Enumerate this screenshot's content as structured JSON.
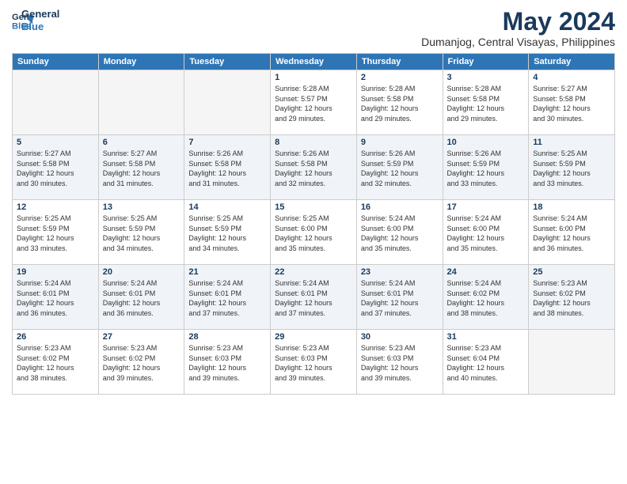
{
  "logo": {
    "line1": "General",
    "line2": "Blue"
  },
  "title": "May 2024",
  "subtitle": "Dumanjog, Central Visayas, Philippines",
  "weekdays": [
    "Sunday",
    "Monday",
    "Tuesday",
    "Wednesday",
    "Thursday",
    "Friday",
    "Saturday"
  ],
  "weeks": [
    [
      {
        "day": "",
        "info": ""
      },
      {
        "day": "",
        "info": ""
      },
      {
        "day": "",
        "info": ""
      },
      {
        "day": "1",
        "info": "Sunrise: 5:28 AM\nSunset: 5:57 PM\nDaylight: 12 hours\nand 29 minutes."
      },
      {
        "day": "2",
        "info": "Sunrise: 5:28 AM\nSunset: 5:58 PM\nDaylight: 12 hours\nand 29 minutes."
      },
      {
        "day": "3",
        "info": "Sunrise: 5:28 AM\nSunset: 5:58 PM\nDaylight: 12 hours\nand 29 minutes."
      },
      {
        "day": "4",
        "info": "Sunrise: 5:27 AM\nSunset: 5:58 PM\nDaylight: 12 hours\nand 30 minutes."
      }
    ],
    [
      {
        "day": "5",
        "info": "Sunrise: 5:27 AM\nSunset: 5:58 PM\nDaylight: 12 hours\nand 30 minutes."
      },
      {
        "day": "6",
        "info": "Sunrise: 5:27 AM\nSunset: 5:58 PM\nDaylight: 12 hours\nand 31 minutes."
      },
      {
        "day": "7",
        "info": "Sunrise: 5:26 AM\nSunset: 5:58 PM\nDaylight: 12 hours\nand 31 minutes."
      },
      {
        "day": "8",
        "info": "Sunrise: 5:26 AM\nSunset: 5:58 PM\nDaylight: 12 hours\nand 32 minutes."
      },
      {
        "day": "9",
        "info": "Sunrise: 5:26 AM\nSunset: 5:59 PM\nDaylight: 12 hours\nand 32 minutes."
      },
      {
        "day": "10",
        "info": "Sunrise: 5:26 AM\nSunset: 5:59 PM\nDaylight: 12 hours\nand 33 minutes."
      },
      {
        "day": "11",
        "info": "Sunrise: 5:25 AM\nSunset: 5:59 PM\nDaylight: 12 hours\nand 33 minutes."
      }
    ],
    [
      {
        "day": "12",
        "info": "Sunrise: 5:25 AM\nSunset: 5:59 PM\nDaylight: 12 hours\nand 33 minutes."
      },
      {
        "day": "13",
        "info": "Sunrise: 5:25 AM\nSunset: 5:59 PM\nDaylight: 12 hours\nand 34 minutes."
      },
      {
        "day": "14",
        "info": "Sunrise: 5:25 AM\nSunset: 5:59 PM\nDaylight: 12 hours\nand 34 minutes."
      },
      {
        "day": "15",
        "info": "Sunrise: 5:25 AM\nSunset: 6:00 PM\nDaylight: 12 hours\nand 35 minutes."
      },
      {
        "day": "16",
        "info": "Sunrise: 5:24 AM\nSunset: 6:00 PM\nDaylight: 12 hours\nand 35 minutes."
      },
      {
        "day": "17",
        "info": "Sunrise: 5:24 AM\nSunset: 6:00 PM\nDaylight: 12 hours\nand 35 minutes."
      },
      {
        "day": "18",
        "info": "Sunrise: 5:24 AM\nSunset: 6:00 PM\nDaylight: 12 hours\nand 36 minutes."
      }
    ],
    [
      {
        "day": "19",
        "info": "Sunrise: 5:24 AM\nSunset: 6:01 PM\nDaylight: 12 hours\nand 36 minutes."
      },
      {
        "day": "20",
        "info": "Sunrise: 5:24 AM\nSunset: 6:01 PM\nDaylight: 12 hours\nand 36 minutes."
      },
      {
        "day": "21",
        "info": "Sunrise: 5:24 AM\nSunset: 6:01 PM\nDaylight: 12 hours\nand 37 minutes."
      },
      {
        "day": "22",
        "info": "Sunrise: 5:24 AM\nSunset: 6:01 PM\nDaylight: 12 hours\nand 37 minutes."
      },
      {
        "day": "23",
        "info": "Sunrise: 5:24 AM\nSunset: 6:01 PM\nDaylight: 12 hours\nand 37 minutes."
      },
      {
        "day": "24",
        "info": "Sunrise: 5:24 AM\nSunset: 6:02 PM\nDaylight: 12 hours\nand 38 minutes."
      },
      {
        "day": "25",
        "info": "Sunrise: 5:23 AM\nSunset: 6:02 PM\nDaylight: 12 hours\nand 38 minutes."
      }
    ],
    [
      {
        "day": "26",
        "info": "Sunrise: 5:23 AM\nSunset: 6:02 PM\nDaylight: 12 hours\nand 38 minutes."
      },
      {
        "day": "27",
        "info": "Sunrise: 5:23 AM\nSunset: 6:02 PM\nDaylight: 12 hours\nand 39 minutes."
      },
      {
        "day": "28",
        "info": "Sunrise: 5:23 AM\nSunset: 6:03 PM\nDaylight: 12 hours\nand 39 minutes."
      },
      {
        "day": "29",
        "info": "Sunrise: 5:23 AM\nSunset: 6:03 PM\nDaylight: 12 hours\nand 39 minutes."
      },
      {
        "day": "30",
        "info": "Sunrise: 5:23 AM\nSunset: 6:03 PM\nDaylight: 12 hours\nand 39 minutes."
      },
      {
        "day": "31",
        "info": "Sunrise: 5:23 AM\nSunset: 6:04 PM\nDaylight: 12 hours\nand 40 minutes."
      },
      {
        "day": "",
        "info": ""
      }
    ]
  ]
}
